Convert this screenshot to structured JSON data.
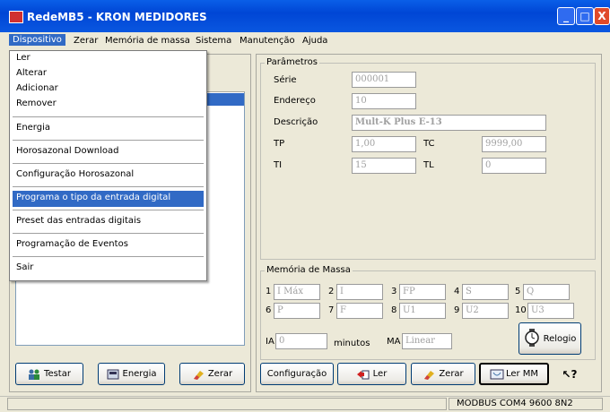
{
  "window": {
    "title": "RedeMB5 - KRON MEDIDORES",
    "minimize": "_",
    "maximize": "□",
    "close": "X"
  },
  "menubar": {
    "items": [
      "Dispositivo",
      "Zerar",
      "Memória de massa",
      "Sistema",
      "Manutenção",
      "Ajuda"
    ]
  },
  "dropdown": {
    "items": [
      "Ler",
      "Alterar",
      "Adicionar",
      "Remover",
      "Energia",
      "Horosazonal Download",
      "Configuração Horosazonal",
      "Programa o tipo da entrada digital",
      "Preset das entradas digitais",
      "Programação de Eventos",
      "Sair"
    ],
    "highlighted": "Programa o tipo da entrada digital"
  },
  "left_buttons": {
    "testar": "Testar",
    "energia": "Energia",
    "zerar": "Zerar"
  },
  "parametros": {
    "title": "Parâmetros",
    "serie_label": "Série",
    "serie_value": "000001",
    "endereco_label": "Endereço",
    "endereco_value": "10",
    "descricao_label": "Descrição",
    "descricao_value": "Mult-K Plus E-13",
    "tp_label": "TP",
    "tp_value": "1,00",
    "tc_label": "TC",
    "tc_value": "9999,00",
    "ti_label": "TI",
    "ti_value": "15",
    "tl_label": "TL",
    "tl_value": "0"
  },
  "memoria": {
    "title": "Memória de Massa",
    "channels": [
      {
        "num": "1",
        "value": "I Máx"
      },
      {
        "num": "2",
        "value": "I"
      },
      {
        "num": "3",
        "value": "FP"
      },
      {
        "num": "4",
        "value": "S"
      },
      {
        "num": "5",
        "value": "Q"
      },
      {
        "num": "6",
        "value": "P"
      },
      {
        "num": "7",
        "value": "F"
      },
      {
        "num": "8",
        "value": "U1"
      },
      {
        "num": "9",
        "value": "U2"
      },
      {
        "num": "10",
        "value": "U3"
      }
    ],
    "ia_label": "IA",
    "ia_value": "0",
    "minutos_label": "minutos",
    "ma_label": "MA",
    "ma_value": "Linear",
    "relogio": "Relogio"
  },
  "bottom_buttons": {
    "configuracao": "Configuração",
    "ler": "Ler",
    "zerar": "Zerar",
    "ler_mm": "Ler MM",
    "help": "?"
  },
  "statusbar": {
    "connection": "MODBUS COM4 9600 8N2"
  },
  "colors": {
    "titlebar": "#0a57e0",
    "highlight": "#316ac5",
    "face": "#ece9d8"
  }
}
